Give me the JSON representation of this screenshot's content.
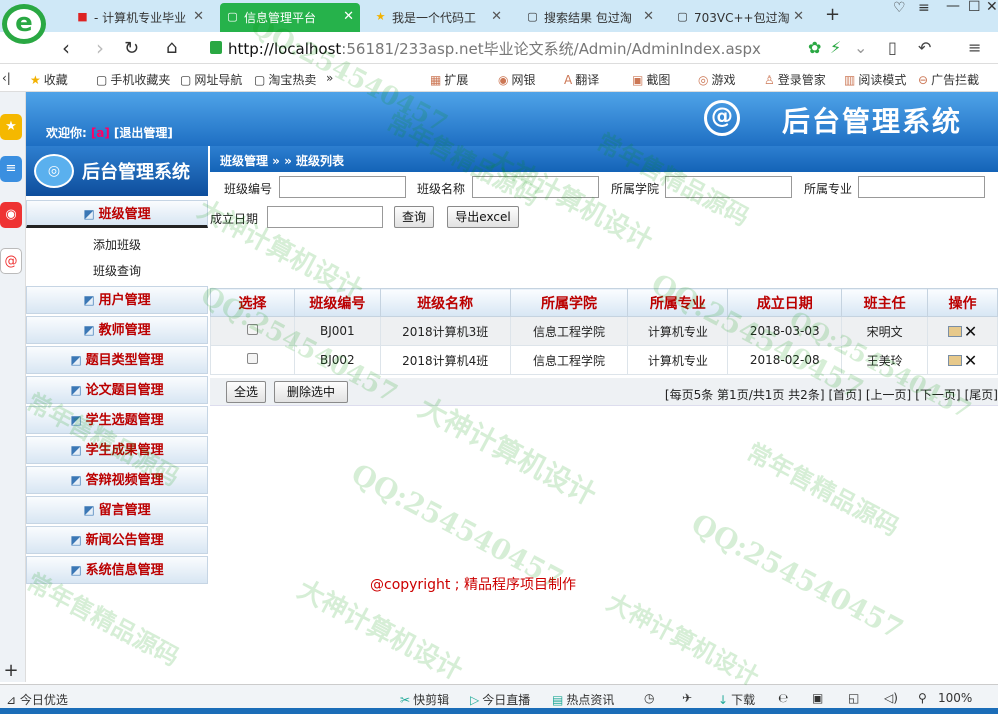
{
  "browser": {
    "tabs": [
      {
        "icon": "flag-icon",
        "icon_glyph": "■",
        "label": "- 计算机专业毕业",
        "active": false
      },
      {
        "icon": "page-icon",
        "icon_glyph": "▢",
        "label": "信息管理平台",
        "active": true
      },
      {
        "icon": "star-icon",
        "icon_glyph": "★",
        "label": "我是一个代码工",
        "active": false
      },
      {
        "icon": "page-icon",
        "icon_glyph": "▢",
        "label": "搜索结果 包过淘",
        "active": false
      },
      {
        "icon": "page-icon",
        "icon_glyph": "▢",
        "label": "703VC++包过淘",
        "active": false
      }
    ],
    "new_tab": "+",
    "url_host": "http://localhost",
    "url_rest": ":56181/233asp.net毕业论文系统/Admin/AdminIndex.aspx",
    "bookmarks": [
      {
        "icon": "★",
        "label": "收藏"
      },
      {
        "icon": "▢",
        "label": "手机收藏夹"
      },
      {
        "icon": "▢",
        "label": "网址导航"
      },
      {
        "icon": "▢",
        "label": "淘宝热卖"
      },
      {
        "icon": "»",
        "label": ""
      }
    ],
    "bookmarks_right": [
      {
        "icon": "▦",
        "label": "扩展"
      },
      {
        "icon": "◉",
        "label": "网银"
      },
      {
        "icon": "A",
        "label": "翻译"
      },
      {
        "icon": "▣",
        "label": "截图"
      },
      {
        "icon": "◎",
        "label": "游戏"
      },
      {
        "icon": "♙",
        "label": "登录管家"
      },
      {
        "icon": "▥",
        "label": "阅读模式"
      },
      {
        "icon": "⊖",
        "label": "广告拦截"
      }
    ],
    "status_left": "今日优选",
    "status_items": [
      {
        "icon": "✂",
        "label": "快剪辑"
      },
      {
        "icon": "▷",
        "label": "今日直播"
      },
      {
        "icon": "▤",
        "label": "热点资讯"
      },
      {
        "icon": "↓",
        "label": "下载"
      }
    ],
    "zoom": "100%"
  },
  "app": {
    "header": {
      "welcome": "欢迎你:",
      "user": "[a]",
      "logout": "[退出管理]",
      "title": "后台管理系统"
    },
    "side_banner": "后台管理系统",
    "menus": [
      {
        "label": "班级管理",
        "sub": [
          "添加班级",
          "班级查询"
        ]
      },
      {
        "label": "用户管理"
      },
      {
        "label": "教师管理"
      },
      {
        "label": "题目类型管理"
      },
      {
        "label": "论文题目管理"
      },
      {
        "label": "学生选题管理"
      },
      {
        "label": "学生成果管理"
      },
      {
        "label": "答辩视频管理"
      },
      {
        "label": "留言管理"
      },
      {
        "label": "新闻公告管理"
      },
      {
        "label": "系统信息管理"
      }
    ],
    "breadcrumb": "班级管理 » » 班级列表",
    "filters": {
      "code": "班级编号",
      "name": "班级名称",
      "college": "所属学院",
      "major": "所属专业",
      "date": "成立日期",
      "query": "查询",
      "export": "导出excel"
    },
    "table": {
      "headers": [
        "选择",
        "班级编号",
        "班级名称",
        "所属学院",
        "所属专业",
        "成立日期",
        "班主任",
        "操作"
      ],
      "rows": [
        {
          "code": "BJ001",
          "name": "2018计算机3班",
          "college": "信息工程学院",
          "major": "计算机专业",
          "date": "2018-03-03",
          "teacher": "宋明文"
        },
        {
          "code": "BJ002",
          "name": "2018计算机4班",
          "college": "信息工程学院",
          "major": "计算机专业",
          "date": "2018-02-08",
          "teacher": "王美玲"
        }
      ]
    },
    "pager": {
      "select_all": "全选",
      "delete_selected": "删除选中",
      "info": "[每页5条 第1页/共1页 共2条]",
      "first": "[首页]",
      "prev": "[上一页]",
      "next": "[下一页]",
      "last": "[尾页]"
    },
    "copyright": "@copyright ; 精品程序项目制作"
  },
  "watermarks": [
    "QQ:254540457",
    "大神计算机设计",
    "常年售精品源码"
  ]
}
